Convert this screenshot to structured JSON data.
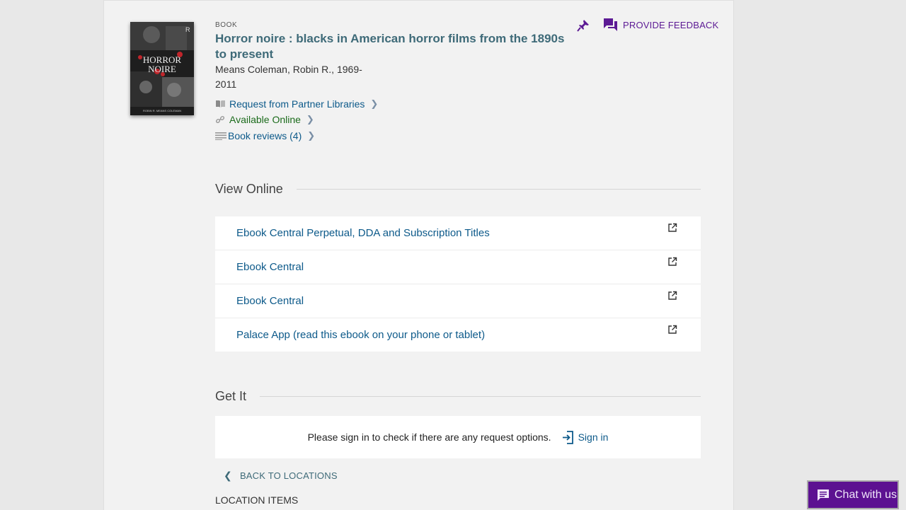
{
  "record": {
    "type": "BOOK",
    "title": "Horror noire : blacks in American horror films from the 1890s to present",
    "author": "Means Coleman, Robin R., 1969-",
    "year": "2011",
    "cover": {
      "title_line1": "HORROR",
      "title_line2": "NOIRE",
      "author_line": "ROBIN R. MEANS COLEMAN"
    }
  },
  "links": [
    {
      "label": "Request from Partner Libraries",
      "icon": "book-open-icon"
    },
    {
      "label": "Available Online",
      "icon": "link-icon"
    },
    {
      "label": "Book reviews (4)",
      "icon": "list-icon"
    }
  ],
  "actions": {
    "feedback_label": "PROVIDE FEEDBACK"
  },
  "view_online": {
    "heading": "View Online",
    "items": [
      "Ebook Central Perpetual, DDA and Subscription Titles",
      "Ebook Central",
      "Ebook Central",
      "Palace App (read this ebook on your phone or tablet)"
    ]
  },
  "get_it": {
    "heading": "Get It",
    "message": "Please sign in to check if there are any request options.",
    "signin_label": "Sign in",
    "back_label": "BACK TO LOCATIONS",
    "location_items_label": "LOCATION ITEMS"
  },
  "chat": {
    "label": "Chat with us"
  },
  "colors": {
    "accent": "#5c1a94",
    "link": "#0d5a8a",
    "available": "#1b6b1b",
    "title": "#3e6a78"
  }
}
